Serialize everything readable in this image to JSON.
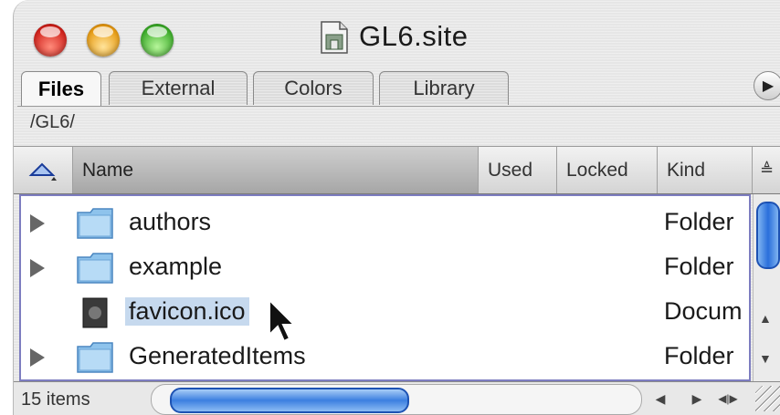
{
  "window": {
    "title": "GL6.site",
    "tabs": [
      {
        "label": "Files",
        "active": true
      },
      {
        "label": "External",
        "active": false
      },
      {
        "label": "Colors",
        "active": false
      },
      {
        "label": "Library",
        "active": false
      }
    ],
    "path": "/GL6/"
  },
  "columns": {
    "name": "Name",
    "used": "Used",
    "locked": "Locked",
    "kind": "Kind"
  },
  "files": [
    {
      "name": "authors",
      "kind": "Folder",
      "icon": "folder-icon",
      "expandable": true,
      "selected": false
    },
    {
      "name": "example",
      "kind": "Folder",
      "icon": "folder-icon",
      "expandable": true,
      "selected": false
    },
    {
      "name": "favicon.ico",
      "kind": "Docum",
      "icon": "document-icon",
      "expandable": false,
      "selected": true
    },
    {
      "name": "GeneratedItems",
      "kind": "Folder",
      "icon": "folder-icon",
      "expandable": true,
      "selected": false
    }
  ],
  "status": {
    "count": "15 items"
  },
  "colors": {
    "selection": "#c6d9ee",
    "list_border": "#7d7dc0",
    "scroll_thumb": "#2a6fdb"
  }
}
